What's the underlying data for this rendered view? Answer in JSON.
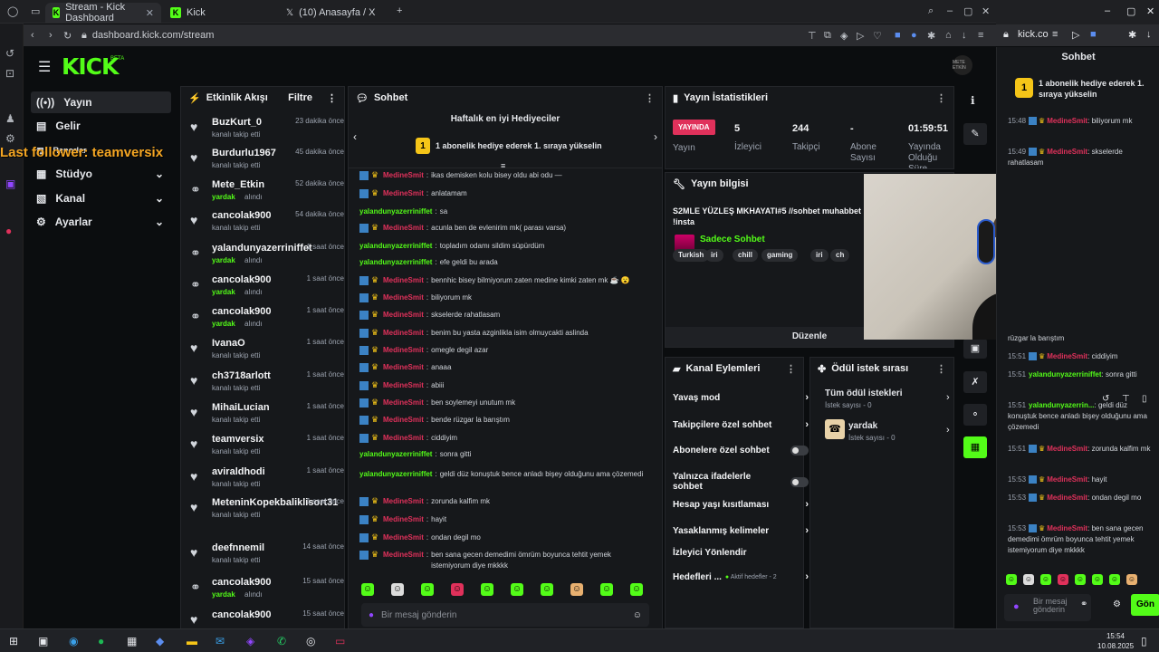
{
  "browser": {
    "tabs": [
      {
        "label": "Stream - Kick Dashboard"
      },
      {
        "label": "Kick"
      },
      {
        "label": "(10) Anasayfa / X"
      }
    ],
    "url": "dashboard.kick.com/stream",
    "url2": "kick.co"
  },
  "overlay": {
    "last_follower": "Last follower: teamversix"
  },
  "brand": {
    "logo": "KICK",
    "beta": "BETA",
    "avatar": "METE ETKİN"
  },
  "nav": {
    "items": [
      {
        "label": "Yayın",
        "icon": "broadcast-icon"
      },
      {
        "label": "Gelir",
        "icon": "wallet-icon"
      },
      {
        "label": "Raporlar",
        "icon": "report-icon"
      },
      {
        "label": "Stüdyo",
        "icon": "studio-icon"
      },
      {
        "label": "Kanal",
        "icon": "channel-icon"
      },
      {
        "label": "Ayarlar",
        "icon": "gear-icon"
      }
    ]
  },
  "activity": {
    "title": "Etkinlik Akışı",
    "filter": "Filtre",
    "items": [
      {
        "name": "BuzKurt_0",
        "time": "23 dakika önce",
        "sub": "kanalı takip etti",
        "green": false
      },
      {
        "name": "Burdurlu1967",
        "time": "45 dakika önce",
        "sub": "kanalı takip etti",
        "green": false
      },
      {
        "name": "Mete_Etkin",
        "time": "52 dakika önce",
        "sub": "yardak",
        "green": true,
        "sub2": "alındı"
      },
      {
        "name": "cancolak900",
        "time": "54 dakika önce",
        "sub": "kanalı takip etti",
        "green": false
      },
      {
        "name": "yalandunyazerriniffet",
        "time": "1 saat önce",
        "sub": "yardak",
        "green": true,
        "sub2": "alındı"
      },
      {
        "name": "cancolak900",
        "time": "1 saat önce",
        "sub": "yardak",
        "green": true,
        "sub2": "alındı"
      },
      {
        "name": "cancolak900",
        "time": "1 saat önce",
        "sub": "yardak",
        "green": true,
        "sub2": "alındı"
      },
      {
        "name": "IvanaO",
        "time": "1 saat önce",
        "sub": "kanalı takip etti",
        "green": false
      },
      {
        "name": "ch3718arlott",
        "time": "1 saat önce",
        "sub": "kanalı takip etti",
        "green": false
      },
      {
        "name": "MihaiLucian",
        "time": "1 saat önce",
        "sub": "kanalı takip etti",
        "green": false
      },
      {
        "name": "teamversix",
        "time": "1 saat önce",
        "sub": "kanalı takip etti",
        "green": false
      },
      {
        "name": "aviraldhodi",
        "time": "1 saat önce",
        "sub": "kanalı takip etti",
        "green": false
      },
      {
        "name": "MeteninKopekbaliklisort31",
        "time": "1 saat önce",
        "sub": "kanalı takip etti",
        "green": false
      },
      {
        "name": "deefnnemil",
        "time": "14 saat önce",
        "sub": "kanalı takip etti",
        "green": false
      },
      {
        "name": "cancolak900",
        "time": "15 saat önce",
        "sub": "yardak",
        "green": true,
        "sub2": "alındı"
      },
      {
        "name": "cancolak900",
        "time": "15 saat önce",
        "sub": "",
        "green": false
      }
    ]
  },
  "chat": {
    "title": "Sohbet",
    "gifter_title": "Haftalık en iyi Hediyeciler",
    "gifter_text": "1 abonelik hediye ederek 1. sıraya yükselin",
    "gifter_rank": "1",
    "input_placeholder": "Bir mesaj gönderin",
    "messages": [
      {
        "user": "MedineSmit",
        "type": "red",
        "text": "ikas demisken kolu bisey oldu abi odu —"
      },
      {
        "user": "MedineSmit",
        "type": "red",
        "text": "anlatamam"
      },
      {
        "user": "yalandunyazerriniffet",
        "type": "green",
        "text": "sa"
      },
      {
        "user": "MedineSmit",
        "type": "red",
        "text": "acunla ben de evlenirim mk( parası varsa)"
      },
      {
        "user": "yalandunyazerriniffet",
        "type": "green",
        "text": "topladım odamı sildim süpürdüm"
      },
      {
        "user": "yalandunyazerriniffet",
        "type": "green",
        "text": "efe geldi bu arada"
      },
      {
        "user": "MedineSmit",
        "type": "red",
        "text": "bennhic bisey bilmiyorum zaten medine kimki zaten mk ☕ 😮"
      },
      {
        "user": "MedineSmit",
        "type": "red",
        "text": "biliyorum mk"
      },
      {
        "user": "MedineSmit",
        "type": "red",
        "text": "skselerde rahatlasam"
      },
      {
        "user": "MedineSmit",
        "type": "red",
        "text": "benim bu yasta azginlikla isim olmuycakti aslinda"
      },
      {
        "user": "MedineSmit",
        "type": "red",
        "text": "omegle degil azar"
      },
      {
        "user": "MedineSmit",
        "type": "red",
        "text": "anaaa"
      },
      {
        "user": "MedineSmit",
        "type": "red",
        "text": "abiii"
      },
      {
        "user": "MedineSmit",
        "type": "red",
        "text": "ben soylemeyi unutum mk"
      },
      {
        "user": "MedineSmit",
        "type": "red",
        "text": "bende rüzgar la barıştım"
      },
      {
        "user": "MedineSmit",
        "type": "red",
        "text": "ciddiyim"
      },
      {
        "user": "yalandunyazerriniffet",
        "type": "green",
        "text": "sonra gitti"
      },
      {
        "user": "yalandunyazerriniffet",
        "type": "green",
        "text": "geldi düz konuştuk bence anladı bişey olduğunu ama çözemedi"
      },
      {
        "user": "MedineSmit",
        "type": "red",
        "text": "zorunda kalfim mk"
      },
      {
        "user": "MedineSmit",
        "type": "red",
        "text": "hayit"
      },
      {
        "user": "MedineSmit",
        "type": "red",
        "text": "ondan degil mo"
      },
      {
        "user": "MedineSmit",
        "type": "red",
        "text": "ben sana gecen demedimi ömrüm boyunca tehtit yemek istemiyorum diye mkkkk"
      }
    ]
  },
  "stats": {
    "title": "Yayın İstatistikleri",
    "live": "YAYINDA",
    "live_sub": "Yayın",
    "viewers": "5",
    "viewers_label": "İzleyici",
    "followers": "244",
    "followers_label": "Takipçi",
    "subs": "-",
    "subs_label": "Abone Sayısı",
    "uptime": "01:59:51",
    "uptime_label": "Yayında Olduğu Süre"
  },
  "info": {
    "title": "Yayın bilgisi",
    "stream_title": "S2MLE YÜZLEŞ MKHAYATI#5 //sohbet muhabbet !insta",
    "category": "Sadece Sohbet",
    "tags": [
      "Turkish",
      "iri",
      "chill",
      "gaming",
      "iri",
      "ch"
    ],
    "edit": "Düzenle"
  },
  "channel_actions": {
    "title": "Kanal Eylemleri",
    "items": [
      {
        "label": "Yavaş mod",
        "kind": "chev"
      },
      {
        "label": "Takipçilere özel sohbet",
        "kind": "chev"
      },
      {
        "label": "Abonelere özel sohbet",
        "kind": "toggle"
      },
      {
        "label": "Yalnızca ifadelerle sohbet",
        "kind": "toggle"
      },
      {
        "label": "Hesap yaşı kısıtlaması",
        "kind": "chev"
      },
      {
        "label": "Yasaklanmış kelimeler",
        "kind": "chev"
      },
      {
        "label": "İzleyici Yönlendir",
        "kind": "none"
      },
      {
        "label": "Hedefleri ...",
        "kind": "chev",
        "extra": "Aktif hedefler - 2"
      }
    ]
  },
  "rewards": {
    "title": "Ödül istek sırası",
    "all": "Tüm ödül istekleri",
    "all_count": "İstek sayısı - 0",
    "item": "yardak",
    "item_count": "İstek sayısı - 0"
  },
  "popout": {
    "title": "Sohbet",
    "gifter_rank": "1",
    "gifter_text": "1 abonelik hediye ederek 1. sıraya yükselin",
    "input_placeholder": "Bir mesaj gönderin",
    "send": "Gön",
    "lines": [
      {
        "time": "15:48",
        "user": "MedineSmit",
        "type": "red",
        "text": "biliyorum mk"
      },
      {
        "time": "15:49",
        "user": "MedineSmit",
        "type": "red",
        "text": "skselerde rahatlasam"
      },
      {
        "time": "",
        "user": "",
        "type": "none",
        "text": "rüzgar la barıştım"
      },
      {
        "time": "15:51",
        "user": "MedineSmit",
        "type": "red",
        "text": "ciddiyim"
      },
      {
        "time": "15:51",
        "user": "yalandunyazerriniffet",
        "type": "green",
        "text": "sonra gitti"
      },
      {
        "time": "15:51",
        "user": "yalandunyazerrin...",
        "type": "green",
        "text": "geldi düz konuştuk bence anladı bişey olduğunu ama çözemedi"
      },
      {
        "time": "15:51",
        "user": "MedineSmit",
        "type": "red",
        "text": "zorunda kalfim mk"
      },
      {
        "time": "15:53",
        "user": "MedineSmit",
        "type": "red",
        "text": "hayit"
      },
      {
        "time": "15:53",
        "user": "MedineSmit",
        "type": "red",
        "text": "ondan degil mo"
      },
      {
        "time": "15:53",
        "user": "MedineSmit",
        "type": "red",
        "text": "ben sana gecen demedimi ömrüm boyunca tehtit yemek istemiyorum diye mkkkk"
      }
    ]
  },
  "taskbar": {
    "time": "15:54",
    "date": "10.08.2025"
  },
  "colors": {
    "kick_green": "#53fc18",
    "live_red": "#e0315b",
    "panel": "#16181b"
  }
}
